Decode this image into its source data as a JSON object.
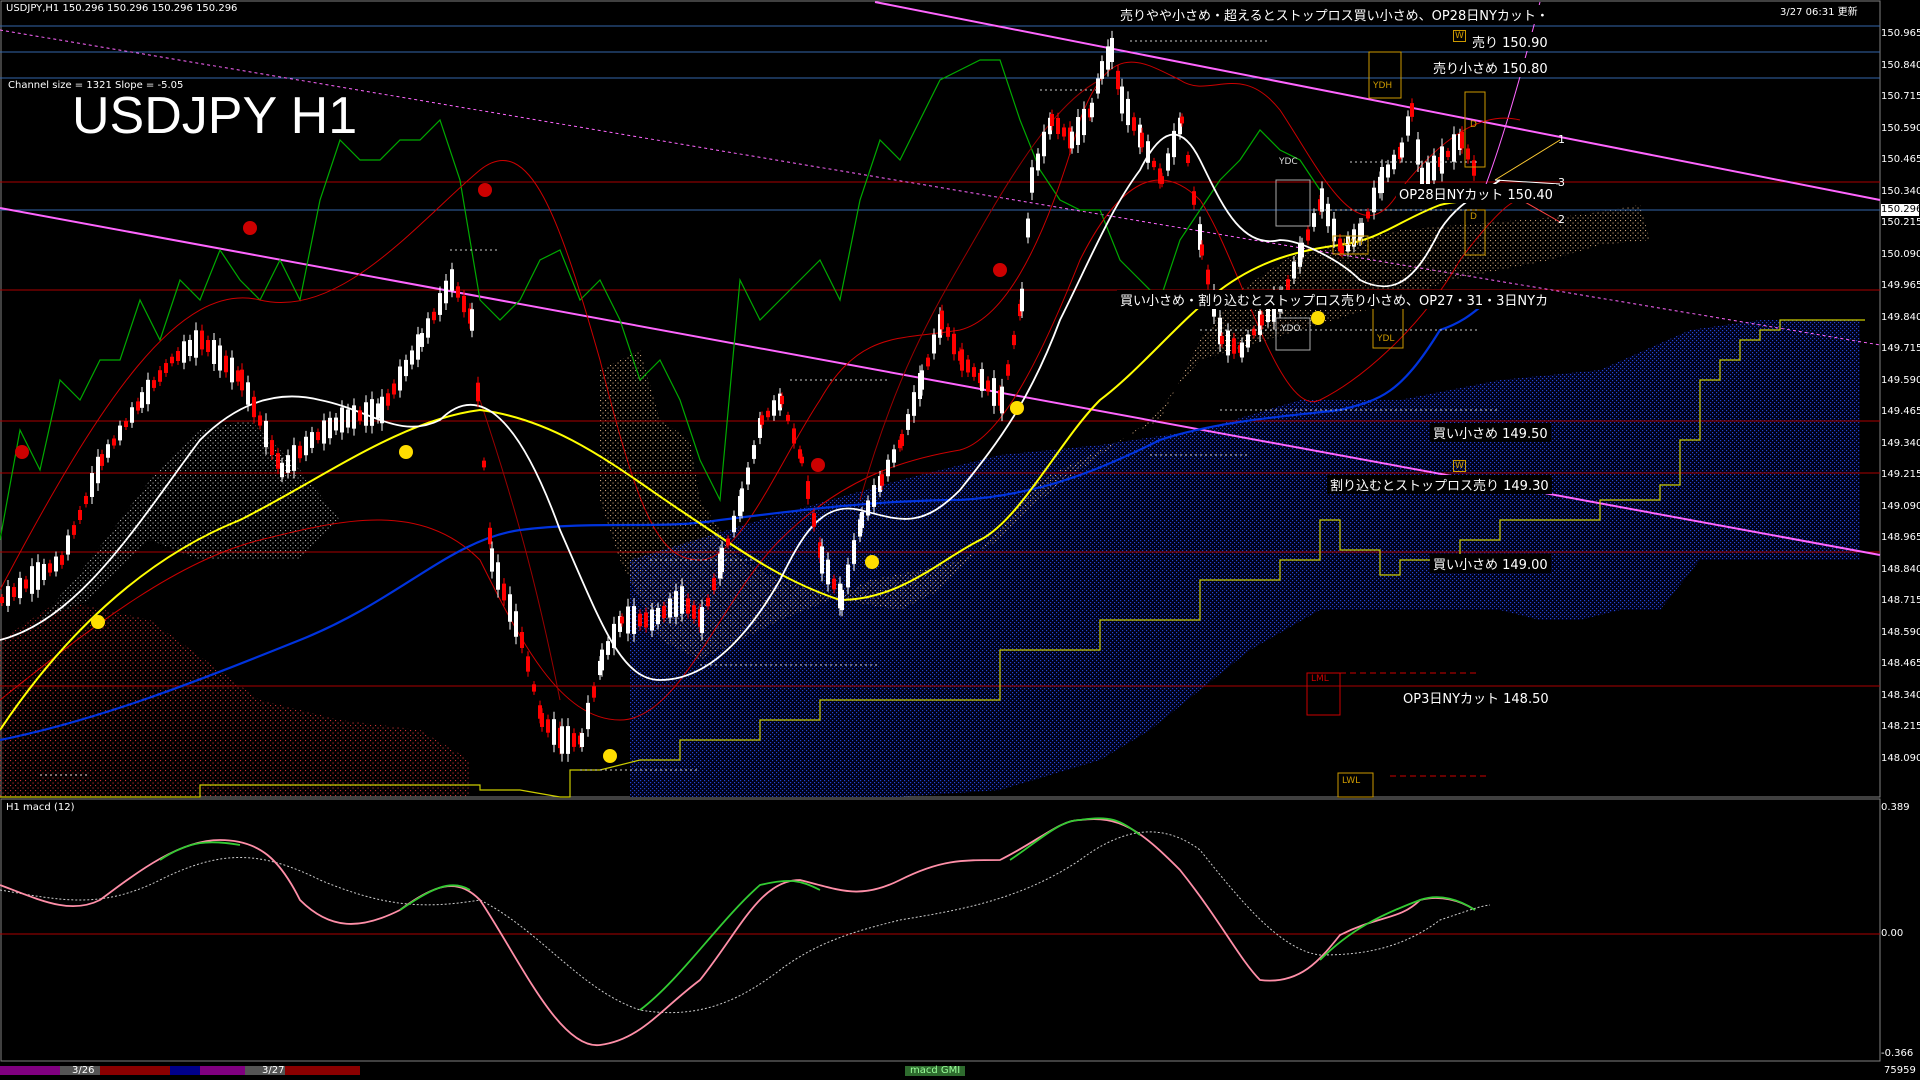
{
  "header": {
    "symbol_line": "USDJPY,H1  150.296 150.296 150.296 150.296",
    "timestamp": "3/27 06:31 更新",
    "channel_info": "Channel size = 1321 Slope = -5.05",
    "big_title": "USDJPY H1"
  },
  "price_axis": {
    "labels": [
      "150.965",
      "150.840",
      "150.715",
      "150.590",
      "150.465",
      "150.340",
      "150.215",
      "150.090",
      "149.965",
      "149.840",
      "149.715",
      "149.590",
      "149.465",
      "149.340",
      "149.215",
      "149.090",
      "148.965",
      "148.840",
      "148.715",
      "148.590",
      "148.465",
      "148.340",
      "148.215",
      "148.090"
    ],
    "current_price": "150.296"
  },
  "annotations": {
    "top_note": "売りやや小さめ・超えるとストップロス買い小さめ、OP28日NYカット・",
    "sell_15090": "売り 150.90",
    "sell_small_15080": "売り小さめ 150.80",
    "op28": "OP28日NYカット 150.40",
    "mid_note": "買い小さめ・割り込むとストップロス売り小さめ、OP27・31・3日NYカ",
    "buy_small_14950": "買い小さめ 149.50",
    "break_sell_14930": "割り込むとストップロス売り 149.30",
    "buy_small_14900": "買い小さめ 149.00",
    "op3": "OP3日NYカット 148.50",
    "level_1": "1",
    "level_2": "2",
    "level_3": "3",
    "box_ydh": "YDH",
    "box_ydc": "YDC",
    "box_ydo": "YDO",
    "box_ydl": "YDL",
    "box_lwh": "LWH",
    "box_lml": "LML",
    "box_lwl": "LWL",
    "box_d": "D",
    "box_w": "W"
  },
  "macd": {
    "title": "H1  macd (12)",
    "axis_top": "0.389",
    "axis_zero": "0.00",
    "axis_bottom": "-0.366"
  },
  "timeline": {
    "date1": "3/26",
    "date2": "3/27",
    "center_label": "macd GMI",
    "right_value": "75959"
  },
  "colors": {
    "background": "#000000",
    "bull_candle": "#ffffff",
    "bear_candle": "#ff0000",
    "sma_fast": "#ffffff",
    "sma_mid": "#ffff00",
    "sma_slow": "#0000ff",
    "chikou": "#00aa00",
    "cloud": "#000080",
    "channel": "#ff66ff",
    "horizontal_red": "#aa0000",
    "horizontal_blue": "#3366aa",
    "macd_up": "#33cc33",
    "macd_down": "#ff8fa8"
  }
}
